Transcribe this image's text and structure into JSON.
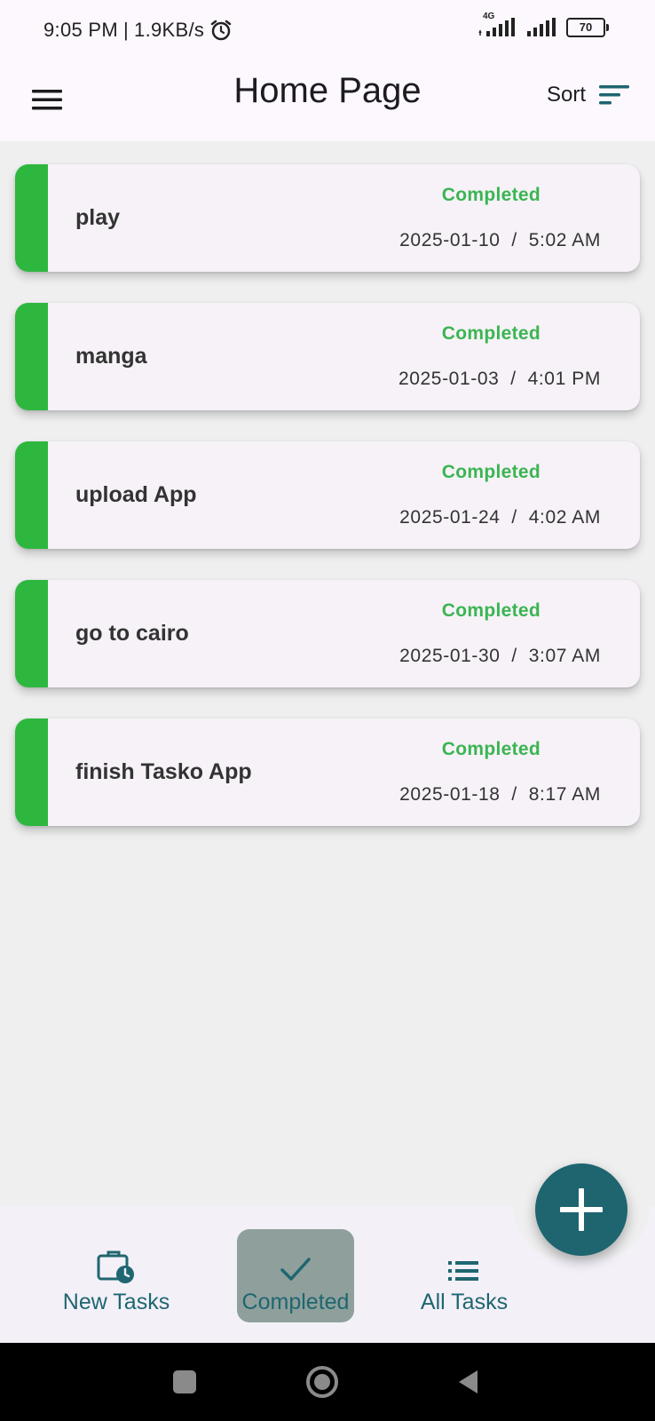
{
  "status_bar": {
    "time": "9:05 PM",
    "separator": "|",
    "speed": "1.9KB/s",
    "network_label": "4G",
    "battery": "70",
    "icons": [
      "alarm-icon",
      "signal-icon",
      "battery-icon"
    ]
  },
  "app_bar": {
    "title": "Home Page",
    "sort_label": "Sort",
    "icons": [
      "menu-icon",
      "sort-icon"
    ]
  },
  "tasks": [
    {
      "title": "play",
      "status": "Completed",
      "date": "2025-01-10",
      "time": "5:02 AM"
    },
    {
      "title": "manga",
      "status": "Completed",
      "date": "2025-01-03",
      "time": "4:01 PM"
    },
    {
      "title": "upload App",
      "status": "Completed",
      "date": "2025-01-24",
      "time": "4:02 AM"
    },
    {
      "title": "go to cairo",
      "status": "Completed",
      "date": "2025-01-30",
      "time": "3:07 AM"
    },
    {
      "title": "finish Tasko App",
      "status": "Completed",
      "date": "2025-01-18",
      "time": "8:17 AM"
    }
  ],
  "bottom_nav": {
    "items": [
      {
        "label": "New Tasks",
        "icon": "briefcase-clock-icon"
      },
      {
        "label": "Completed",
        "icon": "check-icon",
        "selected": true
      },
      {
        "label": "All Tasks",
        "icon": "list-icon"
      }
    ]
  },
  "fab": {
    "icon": "plus-icon"
  },
  "colors": {
    "accent": "#1e6570",
    "completed_green": "#2eb73f",
    "status_text_green": "#3bb552",
    "card_bg": "#f6f2f7",
    "page_bg": "#efeff0"
  }
}
